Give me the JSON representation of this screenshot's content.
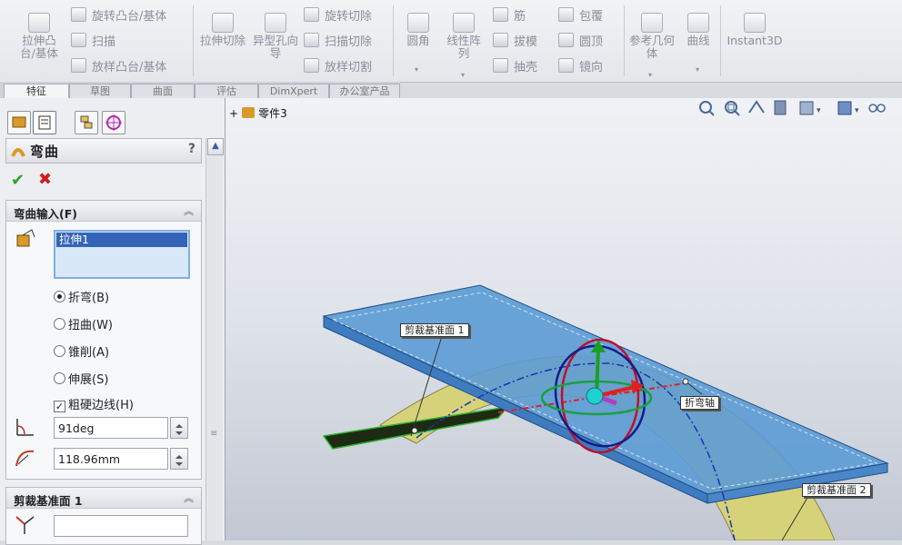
{
  "ribbon": {
    "extrude_boss": "拉伸凸台/基体",
    "revolve_boss": "旋转凸台/基体",
    "sweep": "扫描",
    "loft_boss": "放样凸台/基体",
    "extrude_cut": "拉伸切除",
    "hole_wizard": "异型孔向导",
    "revolve_cut": "旋转切除",
    "sweep_cut": "扫描切除",
    "loft_cut": "放样切割",
    "fillet": "圆角",
    "linear_pattern": "线性阵列",
    "rib": "筋",
    "draft": "拔模",
    "shell": "抽壳",
    "wrap": "包覆",
    "dome": "圆顶",
    "mirror": "镜向",
    "ref_geometry": "参考几何体",
    "curves": "曲线",
    "instant3d": "Instant3D"
  },
  "tabs": [
    {
      "label": "特征"
    },
    {
      "label": "草图"
    },
    {
      "label": "曲面"
    },
    {
      "label": "评估"
    },
    {
      "label": "DimXpert"
    },
    {
      "label": "办公室产品"
    }
  ],
  "property_manager": {
    "title": "弯曲",
    "help": "?",
    "bend_input": {
      "header": "弯曲输入(F)",
      "selection": "拉伸1",
      "options": [
        {
          "label": "折弯(B)",
          "selected": true
        },
        {
          "label": "扭曲(W)",
          "selected": false
        },
        {
          "label": "锥削(A)",
          "selected": false
        },
        {
          "label": "伸展(S)",
          "selected": false
        }
      ],
      "rigid_edges": {
        "label": "粗硬边线(H)",
        "checked": true
      },
      "angle": "91deg",
      "radius": "118.96mm"
    },
    "trim_plane": {
      "header": "剪裁基准面 1",
      "value": ""
    }
  },
  "viewport": {
    "part_name": "零件3",
    "labels": {
      "trim_plane_1": "剪裁基准面 1",
      "trim_plane_2": "剪裁基准面 2",
      "bend_axis": "折弯轴"
    }
  },
  "colors": {
    "body_blue": "#5b9bd5",
    "ring_yellow": "#d6d27a",
    "accent_selected": "#3464b8",
    "ok_green": "#2ea32e",
    "cancel_red": "#d01c1c"
  }
}
